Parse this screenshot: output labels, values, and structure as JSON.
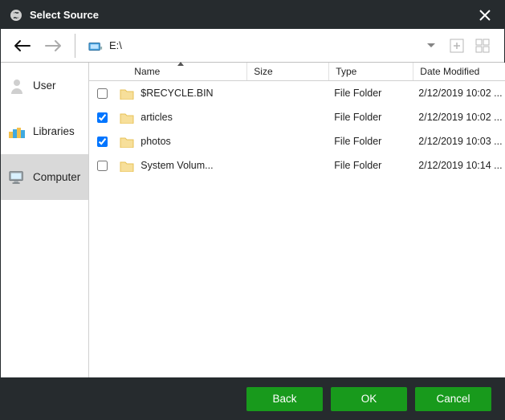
{
  "title": "Select Source",
  "toolbar": {
    "path": "E:\\"
  },
  "sidebar": {
    "items": [
      {
        "label": "User",
        "icon": "user"
      },
      {
        "label": "Libraries",
        "icon": "libraries"
      },
      {
        "label": "Computer",
        "icon": "computer"
      }
    ],
    "selected_index": 2
  },
  "columns": {
    "name": "Name",
    "size": "Size",
    "type": "Type",
    "date": "Date Modified",
    "sort": "name_asc"
  },
  "rows": [
    {
      "checked": false,
      "name": "$RECYCLE.BIN",
      "size": "",
      "type": "File Folder",
      "date": "2/12/2019 10:02 ..."
    },
    {
      "checked": true,
      "name": "articles",
      "size": "",
      "type": "File Folder",
      "date": "2/12/2019 10:02 ..."
    },
    {
      "checked": true,
      "name": "photos",
      "size": "",
      "type": "File Folder",
      "date": "2/12/2019 10:03 ..."
    },
    {
      "checked": false,
      "name": "System Volum...",
      "size": "",
      "type": "File Folder",
      "date": "2/12/2019 10:14 ..."
    }
  ],
  "buttons": {
    "back": "Back",
    "ok": "OK",
    "cancel": "Cancel"
  }
}
